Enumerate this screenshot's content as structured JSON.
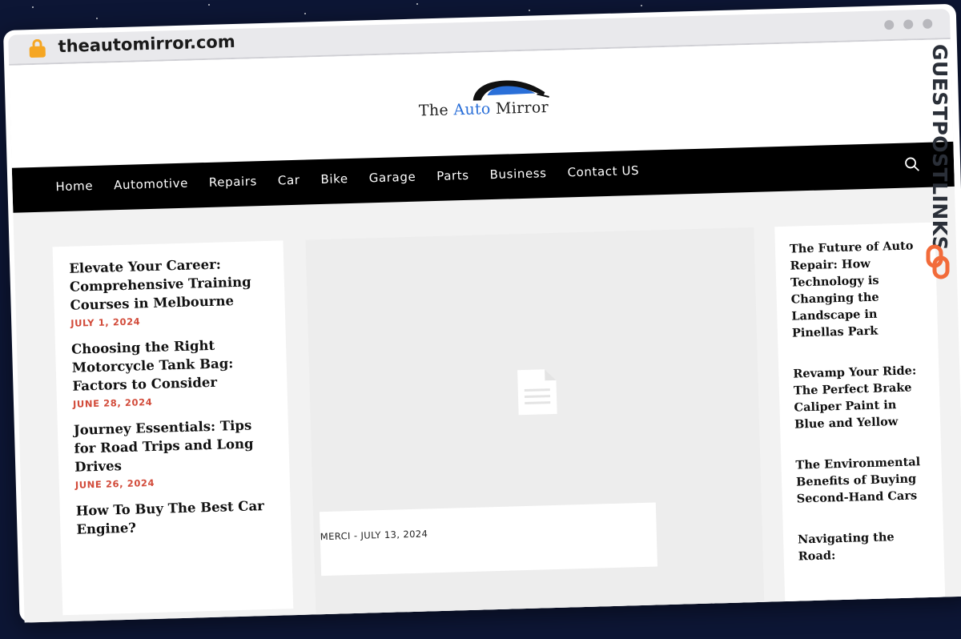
{
  "browser": {
    "url": "theautomirror.com"
  },
  "site": {
    "logo_prefix": "The ",
    "logo_auto": "Auto",
    "logo_suffix": " Mirror"
  },
  "nav": {
    "items": [
      "Home",
      "Automotive",
      "Repairs",
      "Car",
      "Bike",
      "Garage",
      "Parts",
      "Business",
      "Contact US"
    ]
  },
  "left_posts": [
    {
      "title": "Elevate Your Career: Comprehensive Training Courses in Melbourne",
      "date": "JULY 1, 2024"
    },
    {
      "title": "Choosing the Right Motorcycle Tank Bag: Factors to Consider",
      "date": "JUNE 28, 2024"
    },
    {
      "title": "Journey Essentials: Tips for Road Trips and Long Drives",
      "date": "JUNE 26, 2024"
    },
    {
      "title": "How To Buy The Best Car Engine?",
      "date": ""
    }
  ],
  "featured": {
    "meta": "MERCI  - JULY 13, 2024"
  },
  "right_posts": [
    "The Future of Auto Repair: How Technology is Changing the Landscape in Pinellas Park",
    "Revamp Your Ride: The Perfect Brake Caliper Paint in Blue and Yellow",
    "The Environmental Benefits of Buying Second-Hand Cars",
    "Navigating the Road:"
  ],
  "watermark": {
    "text": "GUESTPOSTLINKS"
  },
  "colors": {
    "background": "#0d1635",
    "nav_bg": "#000000",
    "date_red": "#d24b3a",
    "lock_orange": "#f5a623",
    "watermark_orange": "#f26b3a"
  }
}
